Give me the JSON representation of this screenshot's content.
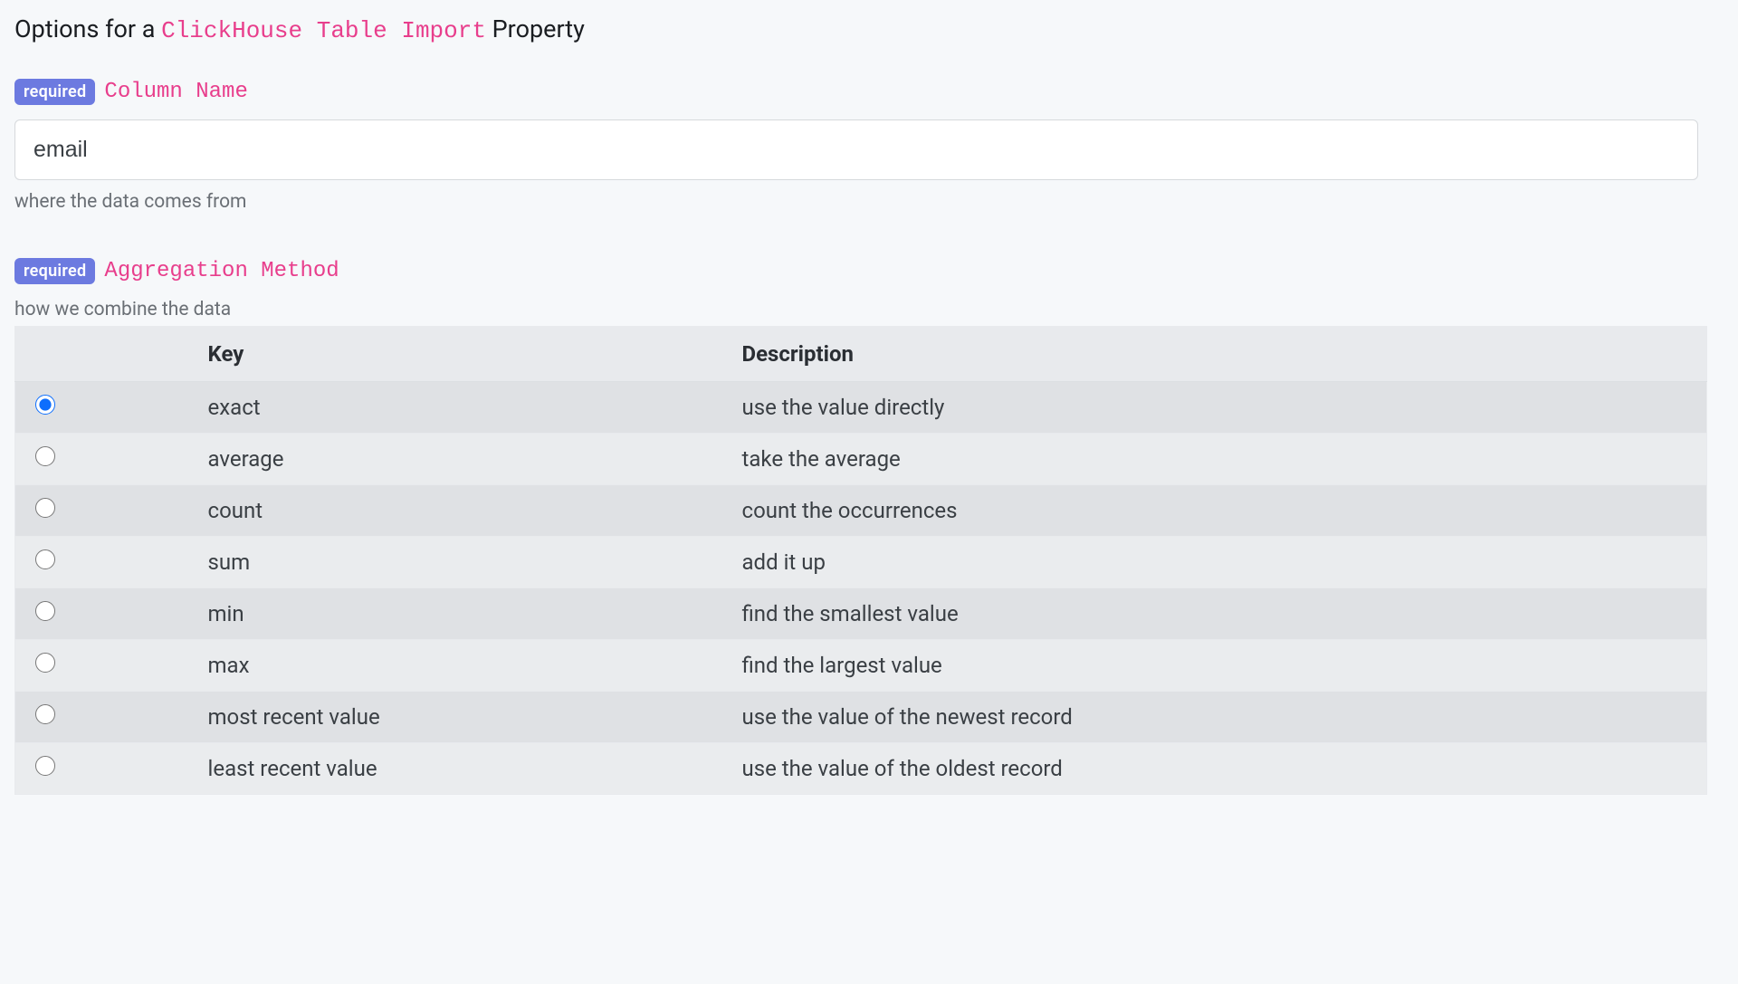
{
  "heading": {
    "prefix": "Options for a ",
    "highlight": "ClickHouse Table Import",
    "suffix": " Property"
  },
  "columnName": {
    "requiredBadge": "required",
    "label": "Column Name",
    "value": "email",
    "help": "where the data comes from"
  },
  "aggregation": {
    "requiredBadge": "required",
    "label": "Aggregation Method",
    "help": "how we combine the data",
    "headers": {
      "key": "Key",
      "description": "Description"
    },
    "selected": "exact",
    "rows": [
      {
        "key": "exact",
        "description": "use the value directly"
      },
      {
        "key": "average",
        "description": "take the average"
      },
      {
        "key": "count",
        "description": "count the occurrences"
      },
      {
        "key": "sum",
        "description": "add it up"
      },
      {
        "key": "min",
        "description": "find the smallest value"
      },
      {
        "key": "max",
        "description": "find the largest value"
      },
      {
        "key": "most recent value",
        "description": "use the value of the newest record"
      },
      {
        "key": "least recent value",
        "description": "use the value of the oldest record"
      }
    ]
  }
}
